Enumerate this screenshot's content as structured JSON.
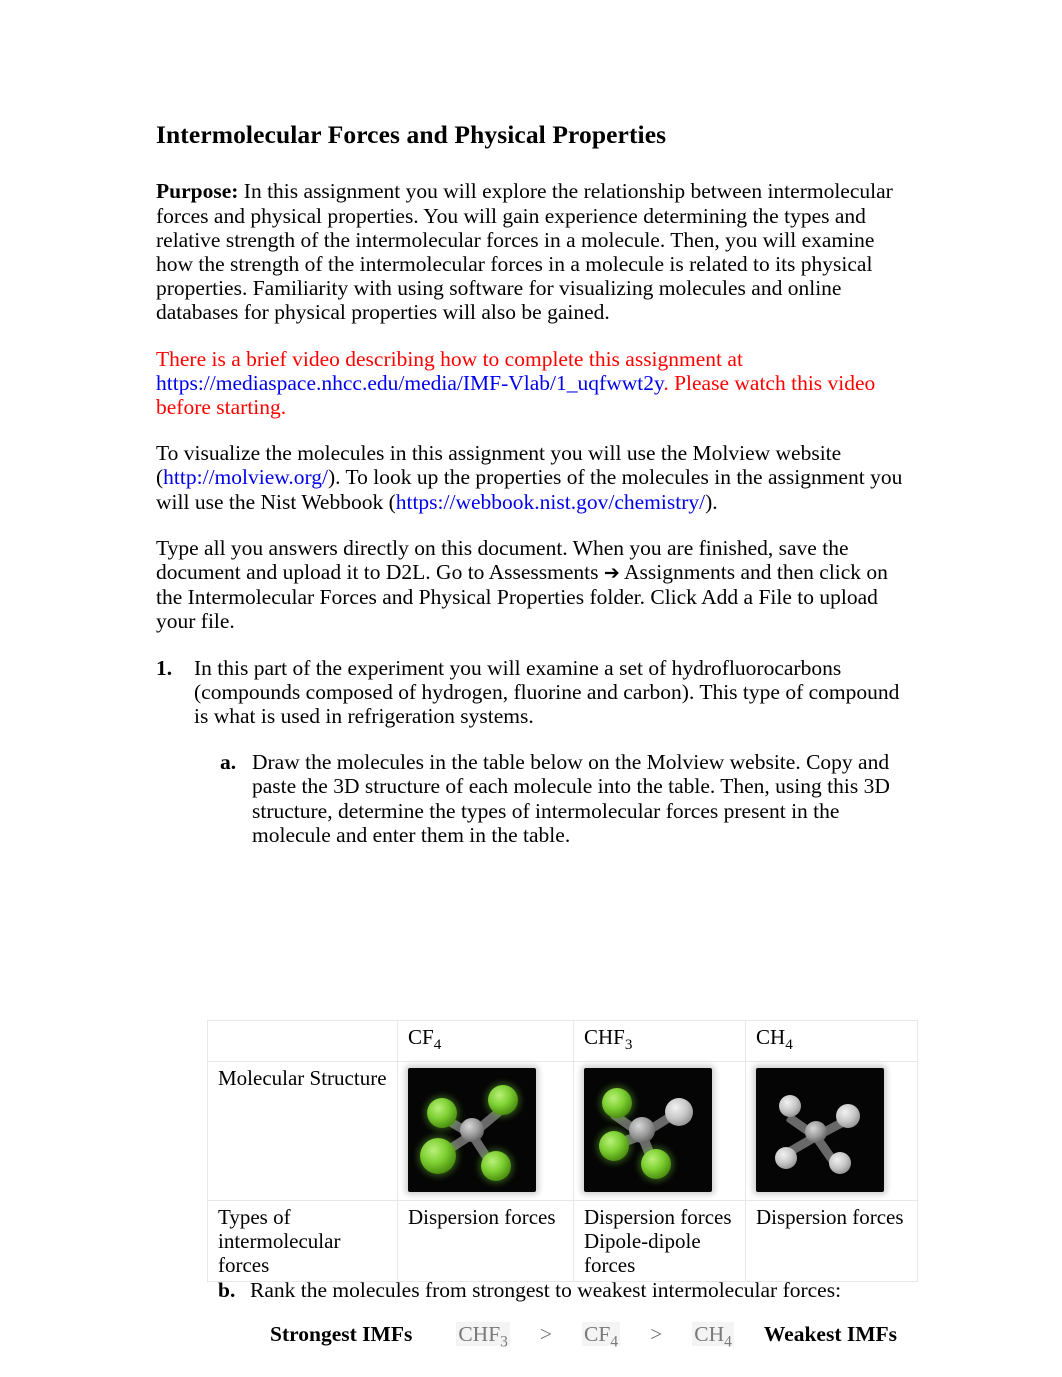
{
  "document": {
    "title": "Intermolecular Forces and Physical Properties"
  },
  "purpose": {
    "label": "Purpose:",
    "text": "  In this assignment you will explore the relationship between intermolecular forces and physical properties.  You will gain experience determining the types and relative strength of the intermolecular forces in a molecule.  Then, you will examine how the strength of the intermolecular forces in a molecule is related to its physical properties.  Familiarity with using software for visualizing molecules and online databases for physical properties will also be gained."
  },
  "video_note": {
    "before_link": "There is a brief video describing how to complete this assignment at ",
    "link": "https://mediaspace.nhcc.edu/media/IMF-Vlab/1_uqfwwt2y",
    "after_link": ".  Please watch this video before starting."
  },
  "websites": {
    "part1": "To visualize the molecules in this assignment you will use the Molview website (",
    "molview_link": "http://molview.org/",
    "part2": ").  To look up the properties of the molecules in the assignment you will use the Nist Webbook (",
    "nist_link": "https://webbook.nist.gov/chemistry/",
    "part3": ")."
  },
  "submission": {
    "part1": "Type all you answers directly on this document.  When you are finished, save the document and upload it to D2L.  Go to Assessments ",
    "arrow": "➔",
    "part2": " Assignments and then click on the Intermolecular Forces and Physical Properties folder.  Click Add a File to upload your file."
  },
  "question_1": {
    "marker": "1.",
    "text": "In this part of the experiment you will examine a set of hydrofluorocarbons (compounds composed of hydrogen, fluorine and carbon).  This type of compound is what is used in refrigeration systems."
  },
  "question_1a": {
    "marker": "a.",
    "text": "Draw the molecules in the table below on the Molview website.  Copy and paste the 3D structure of each molecule into the table.  Then, using this 3D structure, determine the types of intermolecular forces present in the molecule and enter them in the table."
  },
  "table": {
    "corner_label": "",
    "column_headers": [
      {
        "formula": "CF",
        "subscript": "4"
      },
      {
        "formula": "CHF",
        "subscript": "3"
      },
      {
        "formula": "CH",
        "subscript": "4"
      }
    ],
    "row_labels": {
      "structure": "Molecular Structure",
      "forces": "Types of intermolecular forces"
    },
    "forces": [
      "Dispersion forces",
      "Dispersion forces\nDipole-dipole forces",
      "Dispersion forces"
    ],
    "molecule_images": {
      "cf4_alt": "CF4 3D ball model: gray carbon center with four green fluorine atoms",
      "chf3_alt": "CHF3 3D ball model: gray carbon center with three green fluorine atoms and one white hydrogen",
      "ch4_alt": "CH4 3D ball model: gray carbon center with four white hydrogen atoms"
    }
  },
  "question_1b": {
    "marker": "b.",
    "text": "Rank the molecules from strongest to weakest intermolecular forces:",
    "strongest_label": "Strongest IMFs",
    "weakest_label": "Weakest IMFs",
    "answers": [
      {
        "formula": "CHF",
        "subscript": "3"
      },
      {
        "formula": "CF",
        "subscript": "4"
      },
      {
        "formula": "CH",
        "subscript": "4"
      }
    ],
    "separator": ">"
  },
  "colors": {
    "link": "#0000EE",
    "alert_text": "#FF0000",
    "answer_text": "#7A7A7A",
    "answer_highlight": "#F4F4F4",
    "fluorine": "#7FD134",
    "carbon": "#9A9A9A",
    "hydrogen": "#C6C6C6",
    "molecule_background": "#050505"
  }
}
